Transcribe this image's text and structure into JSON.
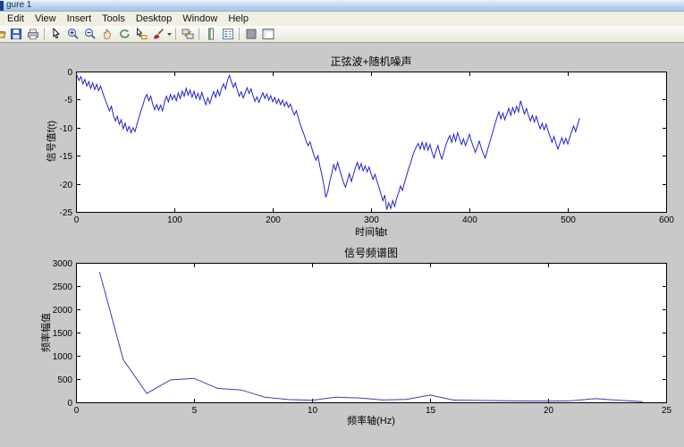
{
  "window": {
    "title": "gure 1"
  },
  "menubar": {
    "items": [
      "Edit",
      "View",
      "Insert",
      "Tools",
      "Desktop",
      "Window",
      "Help"
    ]
  },
  "toolbar": {
    "icons": [
      "open-file",
      "save",
      "print",
      "sep",
      "edit-plot-cursor",
      "zoom-in",
      "zoom-out",
      "pan-hand",
      "rotate-3d",
      "data-cursor",
      "brush-data",
      "brush-caret",
      "sep",
      "link-plot",
      "sep",
      "insert-colorbar",
      "insert-legend",
      "sep",
      "hide-plot-tools",
      "show-plot-tools"
    ]
  },
  "colors": {
    "canvas_bg": "#c9c9c9",
    "axes_bg": "#ffffff",
    "axes_stroke": "#000000",
    "line_top": "#2323cd",
    "line_bottom": "#3c3caf",
    "titlebar_bg": "#b7d3ee"
  },
  "chart_data": [
    {
      "type": "line",
      "title": "正弦波+随机噪声",
      "xlabel": "时间轴t",
      "ylabel": "信号值f(t)",
      "xlim": [
        0,
        600
      ],
      "ylim": [
        -25,
        0
      ],
      "xticks": [
        0,
        100,
        200,
        300,
        400,
        500,
        600
      ],
      "yticks": [
        0,
        -5,
        -10,
        -15,
        -20,
        -25
      ],
      "grid": false,
      "legend": null,
      "color": "#2323cd",
      "points": [
        [
          0,
          -0.3
        ],
        [
          3,
          -1.6
        ],
        [
          5,
          -0.9
        ],
        [
          7,
          -2.2
        ],
        [
          9,
          -1.4
        ],
        [
          11,
          -2.6
        ],
        [
          13,
          -1.8
        ],
        [
          15,
          -3.0
        ],
        [
          17,
          -2.0
        ],
        [
          19,
          -3.2
        ],
        [
          21,
          -2.3
        ],
        [
          23,
          -3.4
        ],
        [
          25,
          -2.6
        ],
        [
          28,
          -4.2
        ],
        [
          31,
          -5.6
        ],
        [
          34,
          -7.0
        ],
        [
          36,
          -6.2
        ],
        [
          38,
          -7.8
        ],
        [
          40,
          -8.8
        ],
        [
          42,
          -8.0
        ],
        [
          44,
          -9.4
        ],
        [
          46,
          -8.6
        ],
        [
          48,
          -10.2
        ],
        [
          50,
          -9.2
        ],
        [
          52,
          -10.6
        ],
        [
          54,
          -9.8
        ],
        [
          56,
          -10.9
        ],
        [
          58,
          -10.0
        ],
        [
          60,
          -10.7
        ],
        [
          62,
          -9.4
        ],
        [
          64,
          -8.2
        ],
        [
          66,
          -7.0
        ],
        [
          68,
          -6.0
        ],
        [
          70,
          -4.8
        ],
        [
          72,
          -4.1
        ],
        [
          74,
          -5.2
        ],
        [
          76,
          -4.4
        ],
        [
          78,
          -5.8
        ],
        [
          80,
          -6.8
        ],
        [
          82,
          -5.9
        ],
        [
          84,
          -6.9
        ],
        [
          86,
          -6.0
        ],
        [
          88,
          -7.0
        ],
        [
          90,
          -5.4
        ],
        [
          92,
          -4.4
        ],
        [
          94,
          -5.4
        ],
        [
          96,
          -4.1
        ],
        [
          98,
          -5.0
        ],
        [
          100,
          -4.2
        ],
        [
          102,
          -5.2
        ],
        [
          104,
          -3.8
        ],
        [
          106,
          -4.8
        ],
        [
          108,
          -3.5
        ],
        [
          110,
          -4.4
        ],
        [
          112,
          -3.0
        ],
        [
          114,
          -4.2
        ],
        [
          116,
          -3.3
        ],
        [
          118,
          -4.6
        ],
        [
          120,
          -3.5
        ],
        [
          122,
          -4.8
        ],
        [
          124,
          -3.9
        ],
        [
          126,
          -5.0
        ],
        [
          128,
          -3.7
        ],
        [
          130,
          -4.9
        ],
        [
          132,
          -5.9
        ],
        [
          134,
          -4.7
        ],
        [
          136,
          -5.7
        ],
        [
          138,
          -4.5
        ],
        [
          140,
          -3.6
        ],
        [
          142,
          -4.6
        ],
        [
          144,
          -3.3
        ],
        [
          146,
          -4.3
        ],
        [
          148,
          -3.0
        ],
        [
          150,
          -2.2
        ],
        [
          152,
          -3.1
        ],
        [
          154,
          -1.6
        ],
        [
          156,
          -0.7
        ],
        [
          158,
          -1.8
        ],
        [
          160,
          -2.8
        ],
        [
          162,
          -2.0
        ],
        [
          164,
          -3.3
        ],
        [
          166,
          -4.4
        ],
        [
          168,
          -3.6
        ],
        [
          170,
          -4.7
        ],
        [
          172,
          -3.8
        ],
        [
          174,
          -2.9
        ],
        [
          176,
          -3.9
        ],
        [
          178,
          -3.1
        ],
        [
          180,
          -4.3
        ],
        [
          182,
          -5.3
        ],
        [
          184,
          -4.5
        ],
        [
          186,
          -5.5
        ],
        [
          188,
          -4.6
        ],
        [
          190,
          -3.8
        ],
        [
          192,
          -4.8
        ],
        [
          194,
          -4.0
        ],
        [
          196,
          -5.1
        ],
        [
          198,
          -4.3
        ],
        [
          200,
          -5.4
        ],
        [
          202,
          -4.6
        ],
        [
          204,
          -5.7
        ],
        [
          206,
          -4.9
        ],
        [
          208,
          -5.9
        ],
        [
          210,
          -5.1
        ],
        [
          212,
          -6.2
        ],
        [
          214,
          -5.4
        ],
        [
          216,
          -6.4
        ],
        [
          218,
          -5.8
        ],
        [
          220,
          -6.9
        ],
        [
          222,
          -7.7
        ],
        [
          224,
          -7.0
        ],
        [
          226,
          -8.2
        ],
        [
          228,
          -9.4
        ],
        [
          230,
          -10.4
        ],
        [
          232,
          -11.3
        ],
        [
          234,
          -12.4
        ],
        [
          236,
          -13.2
        ],
        [
          238,
          -12.5
        ],
        [
          240,
          -13.8
        ],
        [
          242,
          -14.9
        ],
        [
          244,
          -15.8
        ],
        [
          246,
          -15.0
        ],
        [
          248,
          -16.9
        ],
        [
          250,
          -18.4
        ],
        [
          252,
          -20.2
        ],
        [
          254,
          -22.4
        ],
        [
          256,
          -21.4
        ],
        [
          258,
          -19.6
        ],
        [
          260,
          -18.2
        ],
        [
          262,
          -16.6
        ],
        [
          264,
          -17.6
        ],
        [
          266,
          -16.2
        ],
        [
          268,
          -17.4
        ],
        [
          270,
          -18.6
        ],
        [
          272,
          -19.8
        ],
        [
          274,
          -20.6
        ],
        [
          276,
          -19.4
        ],
        [
          278,
          -18.2
        ],
        [
          280,
          -19.6
        ],
        [
          282,
          -18.4
        ],
        [
          284,
          -17.2
        ],
        [
          286,
          -16.2
        ],
        [
          288,
          -17.4
        ],
        [
          290,
          -16.4
        ],
        [
          292,
          -17.7
        ],
        [
          294,
          -16.8
        ],
        [
          296,
          -17.9
        ],
        [
          298,
          -17.0
        ],
        [
          300,
          -18.2
        ],
        [
          302,
          -19.2
        ],
        [
          304,
          -18.3
        ],
        [
          306,
          -19.5
        ],
        [
          308,
          -20.6
        ],
        [
          310,
          -21.8
        ],
        [
          312,
          -23.0
        ],
        [
          314,
          -22.0
        ],
        [
          316,
          -24.6
        ],
        [
          318,
          -23.4
        ],
        [
          320,
          -24.4
        ],
        [
          322,
          -23.0
        ],
        [
          324,
          -24.0
        ],
        [
          326,
          -22.6
        ],
        [
          328,
          -21.6
        ],
        [
          330,
          -20.4
        ],
        [
          332,
          -21.2
        ],
        [
          334,
          -19.8
        ],
        [
          336,
          -18.6
        ],
        [
          338,
          -17.4
        ],
        [
          340,
          -16.4
        ],
        [
          342,
          -15.2
        ],
        [
          344,
          -14.2
        ],
        [
          346,
          -13.4
        ],
        [
          348,
          -12.8
        ],
        [
          350,
          -13.8
        ],
        [
          352,
          -12.6
        ],
        [
          354,
          -13.9
        ],
        [
          356,
          -12.7
        ],
        [
          358,
          -14.0
        ],
        [
          360,
          -13.0
        ],
        [
          362,
          -14.4
        ],
        [
          364,
          -15.4
        ],
        [
          366,
          -14.2
        ],
        [
          368,
          -13.2
        ],
        [
          370,
          -14.6
        ],
        [
          372,
          -15.6
        ],
        [
          374,
          -14.4
        ],
        [
          376,
          -13.1
        ],
        [
          378,
          -12.2
        ],
        [
          380,
          -11.4
        ],
        [
          382,
          -12.6
        ],
        [
          384,
          -11.2
        ],
        [
          386,
          -12.4
        ],
        [
          388,
          -10.9
        ],
        [
          390,
          -12.0
        ],
        [
          392,
          -13.0
        ],
        [
          394,
          -12.0
        ],
        [
          396,
          -13.2
        ],
        [
          398,
          -12.2
        ],
        [
          400,
          -11.2
        ],
        [
          402,
          -12.4
        ],
        [
          404,
          -13.4
        ],
        [
          406,
          -14.4
        ],
        [
          408,
          -13.4
        ],
        [
          410,
          -12.4
        ],
        [
          412,
          -13.6
        ],
        [
          414,
          -14.6
        ],
        [
          416,
          -15.4
        ],
        [
          418,
          -14.2
        ],
        [
          420,
          -13.0
        ],
        [
          422,
          -11.8
        ],
        [
          424,
          -10.6
        ],
        [
          426,
          -9.4
        ],
        [
          428,
          -8.2
        ],
        [
          430,
          -7.2
        ],
        [
          432,
          -8.4
        ],
        [
          434,
          -7.4
        ],
        [
          436,
          -8.6
        ],
        [
          438,
          -7.6
        ],
        [
          440,
          -6.6
        ],
        [
          442,
          -7.8
        ],
        [
          444,
          -6.4
        ],
        [
          446,
          -7.4
        ],
        [
          448,
          -6.2
        ],
        [
          450,
          -7.2
        ],
        [
          452,
          -5.2
        ],
        [
          454,
          -6.4
        ],
        [
          456,
          -7.6
        ],
        [
          458,
          -6.6
        ],
        [
          460,
          -7.8
        ],
        [
          462,
          -8.8
        ],
        [
          464,
          -7.8
        ],
        [
          466,
          -9.0
        ],
        [
          468,
          -8.0
        ],
        [
          470,
          -9.2
        ],
        [
          472,
          -10.2
        ],
        [
          474,
          -9.2
        ],
        [
          476,
          -10.4
        ],
        [
          478,
          -9.4
        ],
        [
          480,
          -10.6
        ],
        [
          482,
          -11.6
        ],
        [
          484,
          -12.6
        ],
        [
          486,
          -11.6
        ],
        [
          488,
          -12.8
        ],
        [
          490,
          -13.8
        ],
        [
          492,
          -12.8
        ],
        [
          494,
          -11.8
        ],
        [
          496,
          -12.9
        ],
        [
          498,
          -11.9
        ],
        [
          500,
          -12.9
        ],
        [
          502,
          -11.7
        ],
        [
          504,
          -10.7
        ],
        [
          506,
          -9.7
        ],
        [
          508,
          -10.7
        ],
        [
          510,
          -9.5
        ],
        [
          512,
          -8.3
        ]
      ]
    },
    {
      "type": "line",
      "title": "信号频谱图",
      "xlabel": "频率轴(Hz)",
      "ylabel": "频率幅值",
      "xlim": [
        0,
        25
      ],
      "ylim": [
        0,
        3000
      ],
      "xticks": [
        0,
        5,
        10,
        15,
        20,
        25
      ],
      "yticks": [
        0,
        500,
        1000,
        1500,
        2000,
        2500,
        3000
      ],
      "grid": false,
      "legend": null,
      "color": "#3c3caf",
      "points": [
        [
          1,
          2800
        ],
        [
          2,
          920
        ],
        [
          3,
          190
        ],
        [
          4,
          480
        ],
        [
          5,
          515
        ],
        [
          6,
          300
        ],
        [
          7,
          265
        ],
        [
          8,
          110
        ],
        [
          9,
          60
        ],
        [
          10,
          45
        ],
        [
          11,
          110
        ],
        [
          12,
          95
        ],
        [
          13,
          50
        ],
        [
          14,
          62
        ],
        [
          15,
          155
        ],
        [
          16,
          48
        ],
        [
          17,
          40
        ],
        [
          18,
          34
        ],
        [
          19,
          28
        ],
        [
          20,
          26
        ],
        [
          21,
          32
        ],
        [
          22,
          78
        ],
        [
          23,
          42
        ],
        [
          24,
          15
        ]
      ]
    }
  ]
}
